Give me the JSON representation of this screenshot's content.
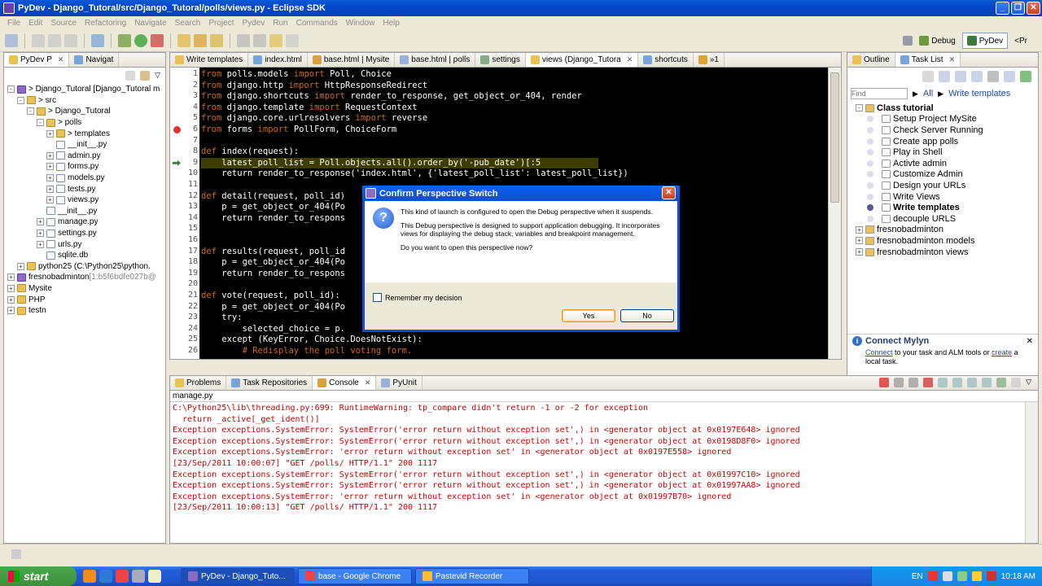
{
  "window": {
    "title": "PyDev - Django_Tutoral/src/Django_Tutoral/polls/views.py - Eclipse SDK"
  },
  "menu": [
    "File",
    "Edit",
    "Source",
    "Refactoring",
    "Navigate",
    "Search",
    "Project",
    "Pydev",
    "Run",
    "Commands",
    "Window",
    "Help"
  ],
  "perspectives": {
    "debug": "Debug",
    "pydev": "PyDev",
    "more": "<Pr"
  },
  "left_tabs": [
    {
      "label": "PyDev P"
    },
    {
      "label": "Navigat"
    }
  ],
  "tree": [
    {
      "label": "> Django_Tutoral [Django_Tutoral m",
      "indent": 0,
      "kind": "proj",
      "exp": "-"
    },
    {
      "label": "> src",
      "indent": 1,
      "kind": "folder",
      "exp": "-"
    },
    {
      "label": "> Django_Tutoral",
      "indent": 2,
      "kind": "folder",
      "exp": "-"
    },
    {
      "label": "> polls",
      "indent": 3,
      "kind": "folder",
      "exp": "-"
    },
    {
      "label": "> templates",
      "indent": 4,
      "kind": "folder",
      "exp": "+"
    },
    {
      "label": "__init__.py",
      "indent": 4,
      "kind": "pyfile",
      "exp": ""
    },
    {
      "label": "admin.py",
      "indent": 4,
      "kind": "pyfile",
      "exp": "+"
    },
    {
      "label": "forms.py",
      "indent": 4,
      "kind": "pyfile",
      "exp": "+"
    },
    {
      "label": "models.py",
      "indent": 4,
      "kind": "pyfile",
      "exp": "+"
    },
    {
      "label": "tests.py",
      "indent": 4,
      "kind": "pyfile",
      "exp": "+"
    },
    {
      "label": "views.py",
      "indent": 4,
      "kind": "pyfile",
      "exp": "+"
    },
    {
      "label": "__init__.py",
      "indent": 3,
      "kind": "pyfile",
      "exp": ""
    },
    {
      "label": "manage.py",
      "indent": 3,
      "kind": "pyfile",
      "exp": "+"
    },
    {
      "label": "settings.py",
      "indent": 3,
      "kind": "pyfile",
      "exp": "+"
    },
    {
      "label": "urls.py",
      "indent": 3,
      "kind": "pyfile",
      "exp": "+"
    },
    {
      "label": "sqlite.db",
      "indent": 3,
      "kind": "pyfile",
      "exp": ""
    },
    {
      "label": "python25  (C:\\Python25\\python.",
      "indent": 1,
      "kind": "folder",
      "exp": "+"
    },
    {
      "label": "fresnobadminton",
      "indent": 0,
      "kind": "proj",
      "exp": "+",
      "decor": " [1:b5f6bdfe027b@"
    },
    {
      "label": "Mysite",
      "indent": 0,
      "kind": "folder",
      "exp": "+"
    },
    {
      "label": "PHP",
      "indent": 0,
      "kind": "folder",
      "exp": "+"
    },
    {
      "label": "testn",
      "indent": 0,
      "kind": "folder",
      "exp": "+"
    }
  ],
  "editor_tabs": [
    {
      "label": "Write templates"
    },
    {
      "label": "index.html"
    },
    {
      "label": "base.html | Mysite"
    },
    {
      "label": "base.html | polls"
    },
    {
      "label": "settings"
    },
    {
      "label": "views (Django_Tutora"
    },
    {
      "label": "shortcuts"
    },
    {
      "label": "»1"
    }
  ],
  "code": [
    {
      "n": "1",
      "parts": [
        [
          "kw",
          "from "
        ],
        [
          "",
          "polls.models "
        ],
        [
          "kw",
          "import "
        ],
        [
          "",
          "Poll, Choice"
        ]
      ]
    },
    {
      "n": "2",
      "parts": [
        [
          "kw",
          "from "
        ],
        [
          "",
          "django.http "
        ],
        [
          "kw",
          "import "
        ],
        [
          "",
          "HttpResponseRedirect"
        ]
      ]
    },
    {
      "n": "3",
      "parts": [
        [
          "kw",
          "from "
        ],
        [
          "",
          "django.shortcuts "
        ],
        [
          "kw",
          "import "
        ],
        [
          "",
          "render_to_response, get_object_or_404, render"
        ]
      ]
    },
    {
      "n": "4",
      "parts": [
        [
          "kw",
          "from "
        ],
        [
          "",
          "django.template "
        ],
        [
          "kw",
          "import "
        ],
        [
          "",
          "RequestContext"
        ]
      ]
    },
    {
      "n": "5",
      "parts": [
        [
          "kw",
          "from "
        ],
        [
          "",
          "django.core.urlresolvers "
        ],
        [
          "kw",
          "import "
        ],
        [
          "",
          "reverse"
        ]
      ]
    },
    {
      "n": "6",
      "parts": [
        [
          "kw",
          "from "
        ],
        [
          "",
          "forms "
        ],
        [
          "kw",
          "import "
        ],
        [
          "",
          "PollForm, ChoiceForm"
        ]
      ]
    },
    {
      "n": "7",
      "parts": []
    },
    {
      "n": "8",
      "parts": [
        [
          "kw",
          "def "
        ],
        [
          "",
          "index(request):"
        ]
      ]
    },
    {
      "n": "9",
      "parts": [
        [
          "",
          "    latest_poll_list = Poll.objects.all().order_by('-pub_date')[:5"
        ]
      ],
      "hl": true
    },
    {
      "n": "10",
      "parts": [
        [
          "",
          "    return render_to_response('index.html', {'latest_poll_list': latest_poll_list})"
        ]
      ]
    },
    {
      "n": "11",
      "parts": []
    },
    {
      "n": "12",
      "parts": [
        [
          "kw",
          "def "
        ],
        [
          "",
          "detail(request, poll_id)"
        ]
      ]
    },
    {
      "n": "13",
      "parts": [
        [
          "",
          "    p = get_object_or_404(Po"
        ]
      ]
    },
    {
      "n": "14",
      "parts": [
        [
          "",
          "    return render_to_respons"
        ]
      ]
    },
    {
      "n": "15",
      "parts": []
    },
    {
      "n": "16",
      "parts": []
    },
    {
      "n": "17",
      "parts": [
        [
          "kw",
          "def "
        ],
        [
          "",
          "results(request, poll_id"
        ]
      ]
    },
    {
      "n": "18",
      "parts": [
        [
          "",
          "    p = get_object_or_404(Po"
        ]
      ]
    },
    {
      "n": "19",
      "parts": [
        [
          "",
          "    return render_to_respons"
        ]
      ]
    },
    {
      "n": "20",
      "parts": []
    },
    {
      "n": "21",
      "parts": [
        [
          "kw",
          "def "
        ],
        [
          "",
          "vote(request, poll_id):"
        ]
      ]
    },
    {
      "n": "22",
      "parts": [
        [
          "",
          "    p = get_object_or_404(Po"
        ]
      ]
    },
    {
      "n": "23",
      "parts": [
        [
          "",
          "    try:"
        ]
      ]
    },
    {
      "n": "24",
      "parts": [
        [
          "",
          "        selected_choice = p."
        ]
      ]
    },
    {
      "n": "25",
      "parts": [
        [
          "",
          "    except (KeyError, Choice.DoesNotExist):"
        ]
      ]
    },
    {
      "n": "26",
      "parts": [
        [
          "kw",
          "        # Redisplay the poll voting form."
        ]
      ]
    }
  ],
  "right_tabs": [
    {
      "label": "Outline"
    },
    {
      "label": "Task List"
    }
  ],
  "tasks": {
    "find_placeholder": "Find",
    "all": "All",
    "write_templates_link": "Write templates",
    "items": [
      {
        "label": "Class tutorial",
        "kind": "cat",
        "exp": "-"
      },
      {
        "label": "Setup Project MySite",
        "kind": "task"
      },
      {
        "label": "Check Server Running",
        "kind": "task"
      },
      {
        "label": "Create app polls",
        "kind": "task"
      },
      {
        "label": "Play in Shell",
        "kind": "task"
      },
      {
        "label": "Activte admin",
        "kind": "task"
      },
      {
        "label": "Customize Admin",
        "kind": "task"
      },
      {
        "label": "Design your URLs",
        "kind": "task"
      },
      {
        "label": "Write Views",
        "kind": "task"
      },
      {
        "label": "Write templates",
        "kind": "task-active"
      },
      {
        "label": "decouple URLS",
        "kind": "task"
      },
      {
        "label": "fresnobadminton",
        "kind": "cat2",
        "exp": "+"
      },
      {
        "label": "fresnobadminton models",
        "kind": "cat2",
        "exp": "+"
      },
      {
        "label": "fresnobadminton views",
        "kind": "cat2",
        "exp": "+"
      }
    ]
  },
  "mylyn": {
    "title": "Connect Mylyn",
    "connect": "Connect",
    "mid": " to your task and ALM tools or ",
    "create": "create",
    "tail": " a local task."
  },
  "dialog": {
    "title": "Confirm Perspective Switch",
    "p1": "This kind of launch is configured to open the Debug perspective when it suspends.",
    "p2": "This Debug perspective is designed to support application debugging.  It incorporates views for displaying the debug stack, variables and breakpoint management.",
    "p3": "Do you want to open this perspective now?",
    "remember": "Remember my decision",
    "yes": "Yes",
    "no": "No"
  },
  "bottom_tabs": [
    {
      "label": "Problems"
    },
    {
      "label": "Task Repositories"
    },
    {
      "label": "Console"
    },
    {
      "label": "PyUnit"
    }
  ],
  "console": {
    "header": "manage.py",
    "lines": [
      {
        "t": "C:\\Python25\\lib\\threading.py:699: RuntimeWarning: tp_compare didn't return -1 or -2 for exception",
        "err": true
      },
      {
        "t": "  return _active[_get_ident()]",
        "err": true
      },
      {
        "t": "Exception exceptions.SystemError: SystemError('error return without exception set',) in <generator object at 0x0197E648> ignored",
        "err": true
      },
      {
        "t": "Exception exceptions.SystemError: SystemError('error return without exception set',) in <generator object at 0x0198D8F0> ignored",
        "err": true
      },
      {
        "t": "Exception exceptions.SystemError: 'error return without exception set' in <generator object at 0x0197E558> ignored",
        "err": true
      },
      {
        "t": "[23/Sep/2011 10:00:07] \"GET /polls/ HTTP/1.1\" 200 1117",
        "err": true
      },
      {
        "t": "Exception exceptions.SystemError: SystemError('error return without exception set',) in <generator object at 0x01997C10> ignored",
        "err": true
      },
      {
        "t": "Exception exceptions.SystemError: SystemError('error return without exception set',) in <generator object at 0x01997AA8> ignored",
        "err": true
      },
      {
        "t": "Exception exceptions.SystemError: 'error return without exception set' in <generator object at 0x01997B70> ignored",
        "err": true
      },
      {
        "t": "[23/Sep/2011 10:00:13] \"GET /polls/ HTTP/1.1\" 200 1117",
        "err": true
      }
    ]
  },
  "taskbar": {
    "start": "start",
    "tasks": [
      {
        "label": "PyDev - Django_Tuto...",
        "active": true
      },
      {
        "label": "base - Google Chrome",
        "active": false
      },
      {
        "label": "Pastevid Recorder",
        "active": false
      }
    ],
    "lang": "EN",
    "clock": "10:18 AM"
  }
}
